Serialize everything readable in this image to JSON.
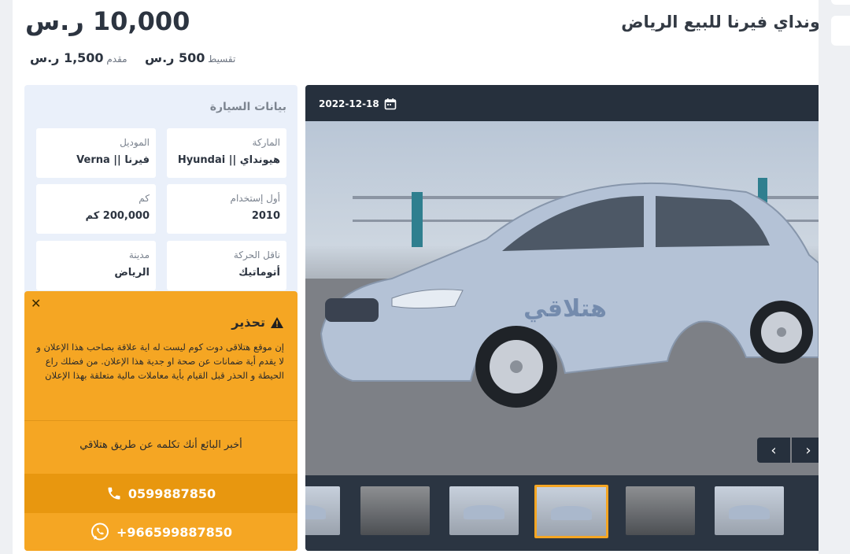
{
  "listing": {
    "title": "ونداي فيرنا للبيع الرياض",
    "price": "10,000 ر.س",
    "installment_label": "تقسيط",
    "installment_value": "500 ر.س",
    "down_label": "مقدم",
    "down_value": "1,500 ر.س"
  },
  "specs": {
    "title": "بيانات السيارة",
    "items": [
      {
        "label": "الماركة",
        "value": "هيونداي || Hyundai"
      },
      {
        "label": "الموديل",
        "value": "فيرنا || Verna"
      },
      {
        "label": "أول إستخدام",
        "value": "2010"
      },
      {
        "label": "كم",
        "value": "200,000 كم"
      },
      {
        "label": "ناقل الحركة",
        "value": "أتوماتيك"
      },
      {
        "label": "مدينة",
        "value": "الرياض"
      }
    ]
  },
  "warning": {
    "close": "✕",
    "title": "تحذير",
    "text": "إن موقع هتلاقى دوت كوم ليست له اية علاقة بصاحب هذا الإعلان و لا يقدم أية ضمانات عن صحة او جدية هذا الإعلان. من فضلك راع الحيطة و الحذر قبل القيام بأية معاملات مالية متعلقة بهذا الإعلان",
    "tell_seller": "أخبر البائع أنك تكلمه عن طريق هتلاقي",
    "phone": "0599887850",
    "whatsapp": "+966599887850"
  },
  "gallery": {
    "date": "2022-12-18",
    "watermark": "هتلاقي",
    "prev": "‹",
    "next": "›",
    "thumb_count": 6,
    "active_thumb": 4
  },
  "icons": {
    "calendar": "calendar-icon",
    "warning": "warning-triangle-icon",
    "phone": "phone-icon",
    "whatsapp": "whatsapp-icon"
  },
  "colors": {
    "accent": "#f5a623",
    "gallery_bg": "#26303d",
    "specs_bg": "#eaf0fa"
  }
}
